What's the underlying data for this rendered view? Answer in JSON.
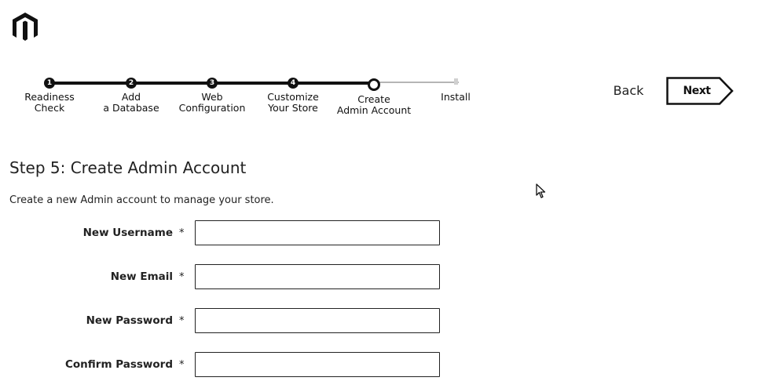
{
  "brand": {
    "logo_icon": "magento-logo-icon"
  },
  "wizard": {
    "steps": [
      {
        "number": "1",
        "label": "Readiness\nCheck",
        "state": "done"
      },
      {
        "number": "2",
        "label": "Add\na Database",
        "state": "done"
      },
      {
        "number": "3",
        "label": "Web\nConfiguration",
        "state": "done"
      },
      {
        "number": "4",
        "label": "Customize\nYour Store",
        "state": "done"
      },
      {
        "number": "",
        "label": "Create\nAdmin Account",
        "state": "current"
      },
      {
        "number": "",
        "label": "Install",
        "state": "pending"
      }
    ]
  },
  "nav": {
    "back_label": "Back",
    "next_label": "Next"
  },
  "page": {
    "title": "Step 5: Create Admin Account",
    "description": "Create a new Admin account to manage your store."
  },
  "form": {
    "required_mark": "*",
    "fields": [
      {
        "label": "New Username",
        "value": "",
        "placeholder": ""
      },
      {
        "label": "New Email",
        "value": "",
        "placeholder": ""
      },
      {
        "label": "New Password",
        "value": "",
        "placeholder": ""
      },
      {
        "label": "Confirm Password",
        "value": "",
        "placeholder": ""
      }
    ]
  },
  "colors": {
    "text": "#1a1a1a",
    "track": "#111111",
    "track_pending": "#b5b5b5",
    "input_border": "#222222"
  }
}
